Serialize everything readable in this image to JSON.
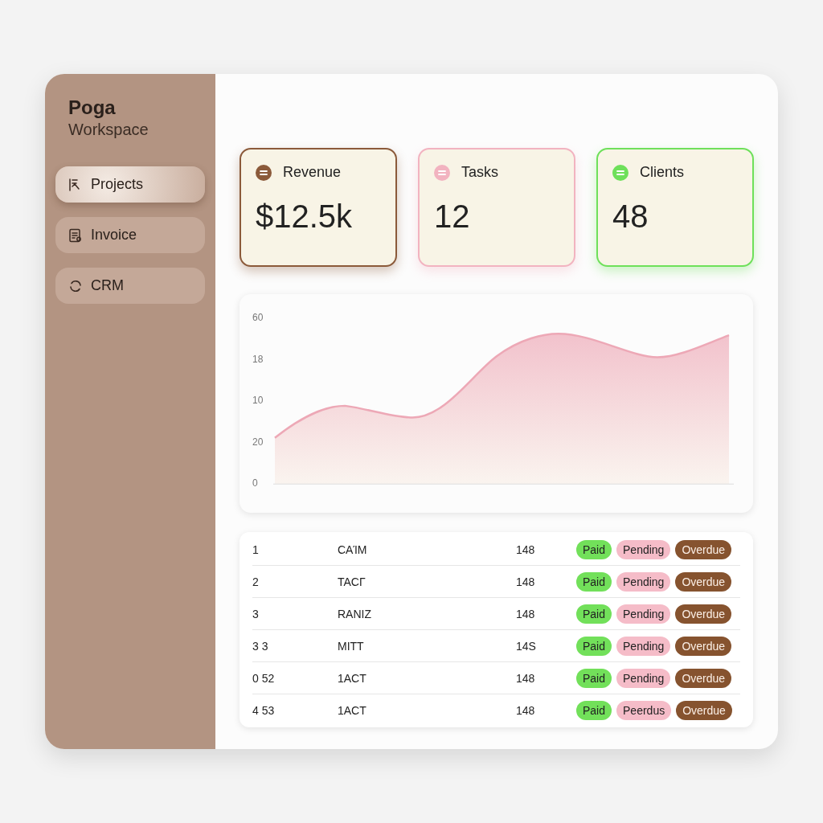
{
  "sidebar": {
    "title": "Poga",
    "subtitle": "Workspace",
    "items": [
      {
        "label": "Projects",
        "kind": "projects",
        "selected": true
      },
      {
        "label": "Invoice",
        "kind": "invoice",
        "selected": false
      },
      {
        "label": "CRM",
        "kind": "crm",
        "selected": false
      }
    ]
  },
  "stats": [
    {
      "label": "Revenue",
      "value": "$12.5k",
      "color": "#8b5a3a"
    },
    {
      "label": "Tasks",
      "value": "12",
      "color": "#f2b3c0"
    },
    {
      "label": "Clients",
      "value": "48",
      "color": "#6ee05a"
    }
  ],
  "chart": {
    "y_axis_labels": [
      "60",
      "18",
      "10",
      "20",
      "0"
    ]
  },
  "table": {
    "rows": [
      {
        "column_1": "1",
        "column_2": "CAΊM",
        "column_3": "148",
        "tags": [
          {
            "label": "Paid",
            "color": "#72e05a"
          },
          {
            "label": "Pending",
            "color": "#f5bcc8"
          },
          {
            "label": "Overdue",
            "color": "#86532f"
          }
        ]
      },
      {
        "column_1": "2",
        "column_2": "TACΓ",
        "column_3": "148",
        "tags": [
          {
            "label": "Paid",
            "color": "#72e05a"
          },
          {
            "label": "Pending",
            "color": "#f5bcc8"
          },
          {
            "label": "Overdue",
            "color": "#86532f"
          }
        ]
      },
      {
        "column_1": "3",
        "column_2": "RANIZ",
        "column_3": "148",
        "tags": [
          {
            "label": "Paid",
            "color": "#72e05a"
          },
          {
            "label": "Pending",
            "color": "#f5bcc8"
          },
          {
            "label": "Overdue",
            "color": "#86532f"
          }
        ]
      },
      {
        "column_1": "3 3",
        "column_2": "MITT",
        "column_3": "14S",
        "tags": [
          {
            "label": "Paid",
            "color": "#72e05a"
          },
          {
            "label": "Pending",
            "color": "#f5bcc8"
          },
          {
            "label": "Overdue",
            "color": "#86532f"
          }
        ]
      },
      {
        "column_1": "0 52",
        "column_2": "1ACT",
        "column_3": "148",
        "tags": [
          {
            "label": "Paid",
            "color": "#72e05a"
          },
          {
            "label": "Pending",
            "color": "#f5bcc8"
          },
          {
            "label": "Overdue",
            "color": "#86532f"
          }
        ]
      },
      {
        "column_1": "4 53",
        "column_2": "1ACT",
        "column_3": "148",
        "tags": [
          {
            "label": "Paid",
            "color": "#72e05a"
          },
          {
            "label": "Peerdus",
            "color": "#f5bcc8"
          },
          {
            "label": "Overdue",
            "color": "#86532f"
          }
        ]
      }
    ]
  }
}
